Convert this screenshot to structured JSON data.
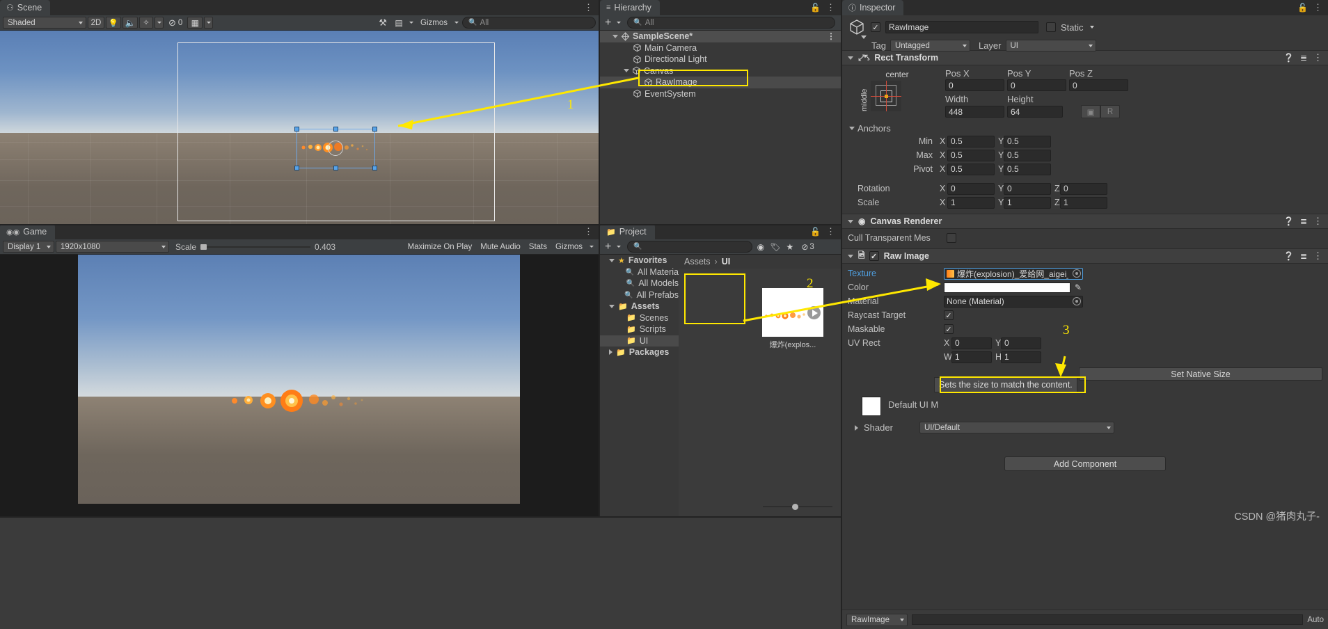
{
  "scene": {
    "tab": "Scene",
    "tab_icon": "grid-hash-icon",
    "toolbar": {
      "shading_mode": "Shaded",
      "mode_2d": "2D",
      "lighting_icon": "lightbulb-icon",
      "audio_icon": "speaker-icon",
      "fx_icon": "effects-icon",
      "hidden_icon": "eye-slash-icon",
      "hidden_count": "0",
      "grid_icon": "grid-snap-icon",
      "tools_icon": "tools-icon",
      "camera_icon": "scene-camera-icon",
      "gizmos_label": "Gizmos",
      "search_placeholder": "All",
      "search_icon": "search-icon"
    }
  },
  "game": {
    "tab": "Game",
    "tab_icon": "gamepad-icon",
    "toolbar": {
      "display": "Display 1",
      "resolution": "1920x1080",
      "scale_label": "Scale",
      "scale_value": "0.403",
      "maximize": "Maximize On Play",
      "mute": "Mute Audio",
      "stats": "Stats",
      "gizmos": "Gizmos"
    }
  },
  "hierarchy": {
    "tab": "Hierarchy",
    "tab_icon": "hierarchy-icon",
    "add_label": "+",
    "search_placeholder": "All",
    "lock_icon": "lock-icon",
    "menu_icon": "kebab-menu-icon",
    "items": [
      {
        "label": "SampleScene*",
        "depth": 0,
        "icon": "unity-scene-icon",
        "expanded": true,
        "selected": false
      },
      {
        "label": "Main Camera",
        "depth": 1,
        "icon": "gameobject-cube-icon",
        "expanded": false,
        "selected": false
      },
      {
        "label": "Directional Light",
        "depth": 1,
        "icon": "gameobject-cube-icon",
        "expanded": false,
        "selected": false
      },
      {
        "label": "Canvas",
        "depth": 1,
        "icon": "gameobject-cube-icon",
        "expanded": true,
        "selected": false
      },
      {
        "label": "RawImage",
        "depth": 2,
        "icon": "gameobject-cube-icon",
        "expanded": false,
        "selected": true
      },
      {
        "label": "EventSystem",
        "depth": 1,
        "icon": "gameobject-cube-icon",
        "expanded": false,
        "selected": false
      }
    ]
  },
  "project": {
    "tab": "Project",
    "tab_icon": "folder-icon",
    "add_label": "+",
    "search_placeholder": "",
    "lock_icon": "lock-icon",
    "menu_icon": "kebab-menu-icon",
    "filter_icons": [
      "package-filter-icon",
      "label-filter-icon",
      "favorite-star-icon"
    ],
    "hidden_icon": "eye-slash-icon",
    "hidden_count": "3",
    "tree": [
      {
        "label": "Favorites",
        "depth": 0,
        "icon": "star-icon",
        "expanded": true,
        "selected": false
      },
      {
        "label": "All Materia",
        "depth": 1,
        "icon": "search-icon",
        "selected": false
      },
      {
        "label": "All Models",
        "depth": 1,
        "icon": "search-icon",
        "selected": false
      },
      {
        "label": "All Prefabs",
        "depth": 1,
        "icon": "search-icon",
        "selected": false
      },
      {
        "label": "Assets",
        "depth": 0,
        "icon": "folder-icon",
        "expanded": true,
        "selected": false
      },
      {
        "label": "Scenes",
        "depth": 1,
        "icon": "folder-icon",
        "selected": false
      },
      {
        "label": "Scripts",
        "depth": 1,
        "icon": "folder-icon",
        "selected": false
      },
      {
        "label": "UI",
        "depth": 1,
        "icon": "folder-icon",
        "selected": true
      },
      {
        "label": "Packages",
        "depth": 0,
        "icon": "folder-icon",
        "expanded": false,
        "selected": false
      }
    ],
    "breadcrumb": [
      "Assets",
      "UI"
    ],
    "asset": {
      "name": "爆炸(explos...",
      "play_icon": "play-overlay-icon"
    },
    "zoom_slider": "asset-size-slider"
  },
  "inspector": {
    "tab": "Inspector",
    "tab_icon": "info-icon",
    "lock_icon": "lock-icon",
    "menu_icon": "kebab-menu-icon",
    "object": {
      "enabled": true,
      "name": "RawImage",
      "static_label": "Static",
      "static_checked": false,
      "tag_label": "Tag",
      "tag_value": "Untagged",
      "layer_label": "Layer",
      "layer_value": "UI",
      "prefab_icon": "gameobject-cube-icon"
    },
    "rect_transform": {
      "title": "Rect Transform",
      "icon": "rect-transform-icon",
      "anchor_preset_top": "center",
      "anchor_preset_side": "middle",
      "pos_x_label": "Pos X",
      "pos_x": "0",
      "pos_y_label": "Pos Y",
      "pos_y": "0",
      "pos_z_label": "Pos Z",
      "pos_z": "0",
      "width_label": "Width",
      "width": "448",
      "height_label": "Height",
      "height": "64",
      "blueprint_icon": "blueprint-mode-icon",
      "raw_edit_label": "R",
      "anchors_label": "Anchors",
      "min_label": "Min",
      "min_x": "0.5",
      "min_y": "0.5",
      "max_label": "Max",
      "max_x": "0.5",
      "max_y": "0.5",
      "pivot_label": "Pivot",
      "pivot_x": "0.5",
      "pivot_y": "0.5",
      "rotation_label": "Rotation",
      "rot_x": "0",
      "rot_y": "0",
      "rot_z": "0",
      "scale_label": "Scale",
      "scale_x": "1",
      "scale_y": "1",
      "scale_z": "1",
      "axis_x": "X",
      "axis_y": "Y",
      "axis_z": "Z"
    },
    "canvas_renderer": {
      "title": "Canvas Renderer",
      "icon": "canvas-renderer-icon",
      "cull_label": "Cull Transparent Mes",
      "cull_checked": false
    },
    "raw_image": {
      "title": "Raw Image",
      "icon": "raw-image-icon",
      "enabled": true,
      "texture_label": "Texture",
      "texture_value": "爆炸(explosion)_爱给网_aigei_",
      "color_label": "Color",
      "color_value": "#FFFFFF",
      "eyedropper_icon": "eyedropper-icon",
      "material_label": "Material",
      "material_value": "None (Material)",
      "raycast_label": "Raycast Target",
      "raycast_checked": true,
      "maskable_label": "Maskable",
      "maskable_checked": true,
      "uvrect_label": "UV Rect",
      "uv_x_axis": "X",
      "uv_x": "0",
      "uv_y_axis": "Y",
      "uv_y": "0",
      "uv_w_axis": "W",
      "uv_w": "1",
      "uv_h_axis": "H",
      "uv_h": "1",
      "set_native_size": "Set Native Size",
      "tooltip": "Sets the size to match the content."
    },
    "material_preview": {
      "name": "Default UI M",
      "shader_label": "Shader",
      "shader_value": "UI/Default"
    },
    "add_component": "Add Component",
    "footer_object": "RawImage",
    "footer_auto": "Auto"
  },
  "annotations": {
    "markers": [
      "1",
      "2",
      "3"
    ],
    "accent_color": "#ffe800"
  },
  "watermark": "CSDN @猪肉丸子-"
}
